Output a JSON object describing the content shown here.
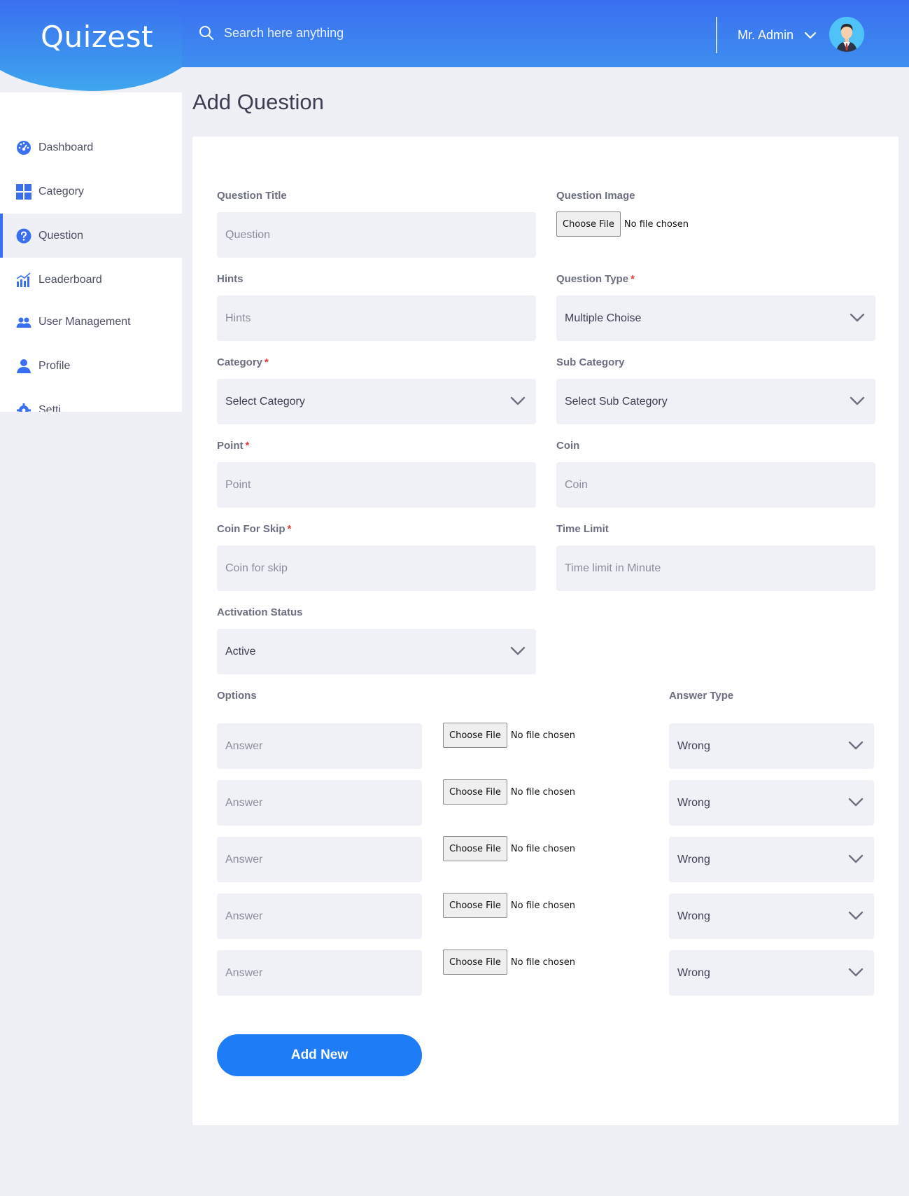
{
  "app": {
    "logo": "Quizest"
  },
  "header": {
    "search_placeholder": "Search here anything",
    "user_name": "Mr. Admin"
  },
  "sidebar": {
    "items": [
      {
        "label": "Dashboard",
        "icon": "dashboard-gauge-icon",
        "active": false
      },
      {
        "label": "Category",
        "icon": "grid-icon",
        "active": false
      },
      {
        "label": "Question",
        "icon": "question-circle-icon",
        "active": true
      },
      {
        "label": "Leaderboard",
        "icon": "bar-chart-icon",
        "active": false
      },
      {
        "label": "User Management",
        "icon": "users-icon",
        "active": false
      },
      {
        "label": "Profile",
        "icon": "user-icon",
        "active": false
      },
      {
        "label": "Setti",
        "icon": "gear-icon",
        "active": false
      }
    ]
  },
  "page": {
    "title": "Add Question"
  },
  "form": {
    "question_title": {
      "label": "Question Title",
      "placeholder": "Question"
    },
    "question_image": {
      "label": "Question Image",
      "button": "Choose File",
      "status": "No file chosen"
    },
    "hints": {
      "label": "Hints",
      "placeholder": "Hints"
    },
    "question_type": {
      "label": "Question Type",
      "value": "Multiple Choise",
      "required": "*"
    },
    "category": {
      "label": "Category",
      "value": "Select Category",
      "required": "*"
    },
    "sub_category": {
      "label": "Sub Category",
      "value": "Select Sub Category"
    },
    "point": {
      "label": "Point",
      "placeholder": "Point",
      "required": "*"
    },
    "coin": {
      "label": "Coin",
      "placeholder": "Coin"
    },
    "coin_for_skip": {
      "label": "Coin For Skip",
      "placeholder": "Coin for skip",
      "required": "*"
    },
    "time_limit": {
      "label": "Time Limit",
      "placeholder": "Time limit in Minute"
    },
    "activation_status": {
      "label": "Activation Status",
      "value": "Active"
    },
    "options_label": "Options",
    "answer_type_label": "Answer Type",
    "options": [
      {
        "placeholder": "Answer",
        "file_button": "Choose File",
        "file_status": "No file chosen",
        "answer_type": "Wrong"
      },
      {
        "placeholder": "Answer",
        "file_button": "Choose File",
        "file_status": "No file chosen",
        "answer_type": "Wrong"
      },
      {
        "placeholder": "Answer",
        "file_button": "Choose File",
        "file_status": "No file chosen",
        "answer_type": "Wrong"
      },
      {
        "placeholder": "Answer",
        "file_button": "Choose File",
        "file_status": "No file chosen",
        "answer_type": "Wrong"
      },
      {
        "placeholder": "Answer",
        "file_button": "Choose File",
        "file_status": "No file chosen",
        "answer_type": "Wrong"
      }
    ],
    "submit_label": "Add New"
  },
  "colors": {
    "header_blue": "#3a6ff0",
    "accent_blue": "#1f7cf7",
    "background": "#eff0f5",
    "field_bg": "#f0f1f6",
    "required_red": "#e03b3b"
  }
}
